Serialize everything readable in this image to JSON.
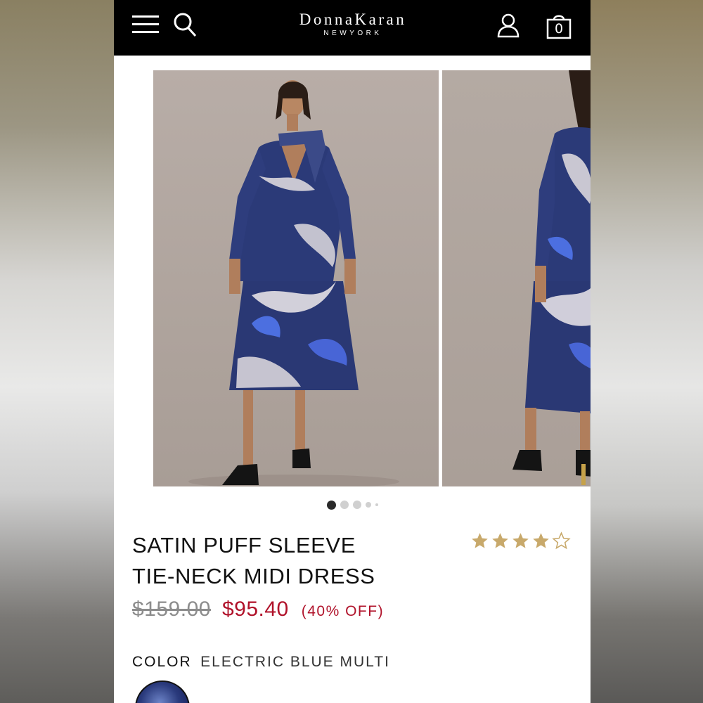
{
  "header": {
    "brand": "DonnaKaran",
    "brand_sub": "NEWYORK",
    "bag_count": "0",
    "icons": [
      "menu-icon",
      "search-icon",
      "account-icon",
      "shopping-bag-icon"
    ]
  },
  "gallery": {
    "images": [
      "product-image-front",
      "product-image-back"
    ],
    "dots_count": 5,
    "active_dot": 1
  },
  "product": {
    "title_line1": "SATIN PUFF SLEEVE",
    "title_line2": "TIE-NECK MIDI DRESS",
    "rating": 4,
    "rating_max": 5,
    "price_original": "$159.00",
    "price_sale": "$95.40",
    "discount": "(40% OFF)",
    "color_label": "COLOR",
    "color_value": "ELECTRIC BLUE MULTI"
  },
  "colors": {
    "header_bg": "#000000",
    "sale": "#b0122a",
    "star": "#c8a96b"
  }
}
